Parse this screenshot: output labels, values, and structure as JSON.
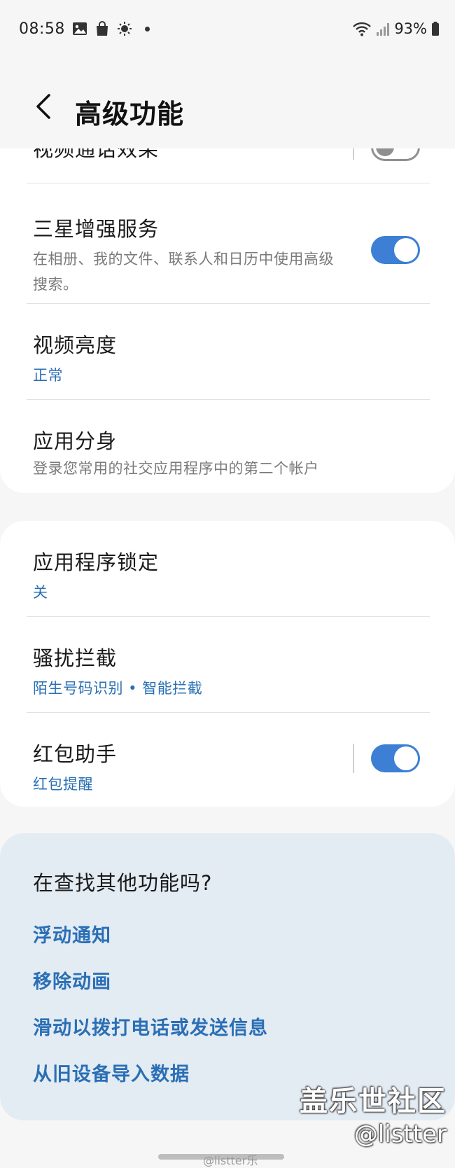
{
  "status_bar": {
    "time": "08:58",
    "battery": "93%",
    "icons": [
      "image-icon",
      "shopping-bag-icon",
      "brightness-icon",
      "notification-dot-icon",
      "wifi-icon",
      "signal-icon",
      "battery-icon"
    ]
  },
  "header": {
    "title": "高级功能",
    "back_icon": "chevron-left-icon"
  },
  "card1": {
    "partial_item": {
      "title": "视频通话效果",
      "toggle_on": false
    },
    "items": [
      {
        "title": "三星增强服务",
        "subtitle": "在相册、我的文件、联系人和日历中使用高级搜索。",
        "toggle_on": true
      },
      {
        "title": "视频亮度",
        "value": "正常"
      },
      {
        "title": "应用分身",
        "subtitle": "登录您常用的社交应用程序中的第二个帐户"
      }
    ]
  },
  "card2": {
    "items": [
      {
        "title": "应用程序锁定",
        "value": "关"
      },
      {
        "title": "骚扰拦截",
        "value": "陌生号码识别 • 智能拦截"
      },
      {
        "title": "红包助手",
        "value": "红包提醒",
        "toggle_on": true
      }
    ]
  },
  "suggestions": {
    "title": "在查找其他功能吗?",
    "links": [
      "浮动通知",
      "移除动画",
      "滑动以拨打电话或发送信息",
      "从旧设备导入数据"
    ]
  },
  "watermark": {
    "brand": "盖乐世社区",
    "handle": "@listter",
    "small": "@listter乐"
  },
  "colors": {
    "accent": "#3c7fd4",
    "link": "#2a6fb5",
    "background": "#f6f6f6",
    "suggest_bg": "#e3ebf3"
  }
}
